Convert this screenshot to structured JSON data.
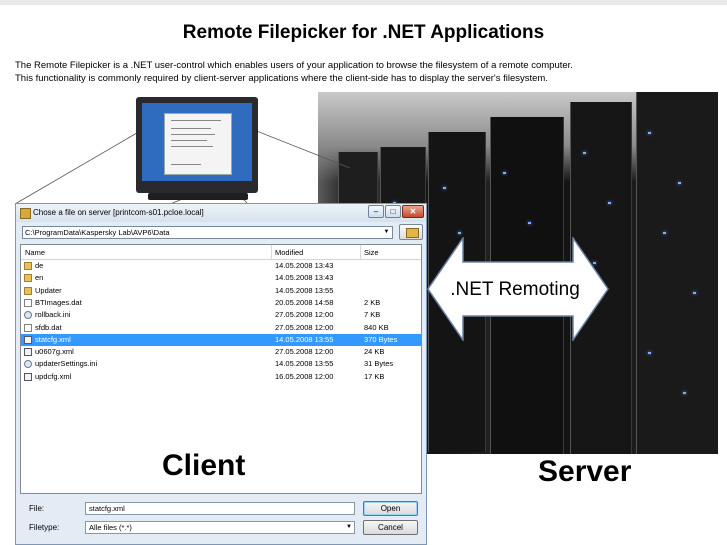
{
  "page": {
    "title": "Remote Filepicker for .NET Applications",
    "intro_line1": "The Remote Filepicker is a .NET user-control which enables users of your application to browse the filesystem of a remote computer.",
    "intro_line2": "This functionality is commonly required by client-server applications where the client-side has to display the server's filesystem."
  },
  "dialog": {
    "title": "Chose a file on server [printcom-s01.pcloe.local]",
    "path": "C:\\ProgramData\\Kaspersky Lab\\AVP6\\Data",
    "columns": {
      "name": "Name",
      "modified": "Modified",
      "size": "Size"
    },
    "rows": [
      {
        "icon": "folder-icon",
        "name": "de",
        "modified": "14.05.2008 13:43",
        "size": ""
      },
      {
        "icon": "folder-icon",
        "name": "en",
        "modified": "14.05.2008 13:43",
        "size": ""
      },
      {
        "icon": "folder-icon",
        "name": "Updater",
        "modified": "14.05.2008 13:55",
        "size": ""
      },
      {
        "icon": "file-icon",
        "name": "BTImages.dat",
        "modified": "20.05.2008 14:58",
        "size": "2 KB"
      },
      {
        "icon": "settings-file-icon",
        "name": "rollback.ini",
        "modified": "27.05.2008 12:00",
        "size": "7 KB"
      },
      {
        "icon": "file-icon",
        "name": "sfdb.dat",
        "modified": "27.05.2008 12:00",
        "size": "840 KB"
      },
      {
        "icon": "xml-file-icon",
        "name": "statcfg.xml",
        "modified": "14.05.2008 13:55",
        "size": "370 Bytes",
        "selected": true
      },
      {
        "icon": "xml-file-icon",
        "name": "u0607g.xml",
        "modified": "27.05.2008 12:00",
        "size": "24 KB"
      },
      {
        "icon": "settings-file-icon",
        "name": "updaterSettings.ini",
        "modified": "14.05.2008 13:55",
        "size": "31 Bytes"
      },
      {
        "icon": "xml-file-icon",
        "name": "updcfg.xml",
        "modified": "16.05.2008 12:00",
        "size": "17 KB"
      }
    ],
    "file_label": "File:",
    "file_value": "statcfg.xml",
    "filetype_label": "Filetype:",
    "filetype_value": "Alle files (*.*)",
    "open_label": "Open",
    "cancel_label": "Cancel"
  },
  "labels": {
    "client": "Client",
    "server": "Server",
    "remoting": ".NET Remoting"
  },
  "colors": {
    "selection": "#3399ff",
    "window_frame": "#e3ecf5",
    "arrow_fill": "#ffffff"
  }
}
